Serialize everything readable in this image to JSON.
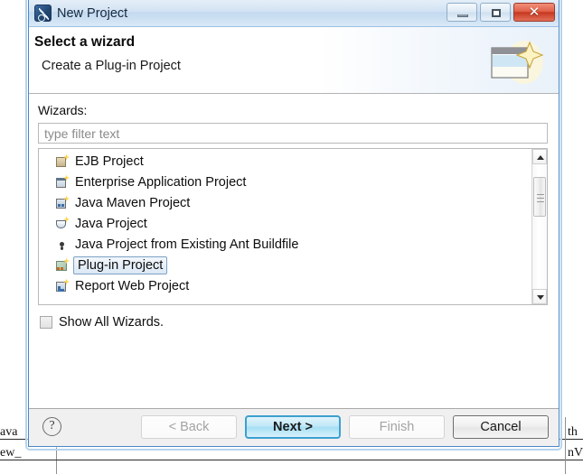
{
  "window": {
    "title": "New Project",
    "icon": "wizard-tool-icon",
    "controls": {
      "minimize": "minimize",
      "maximize": "maximize",
      "close": "✕"
    }
  },
  "header": {
    "title": "Select a wizard",
    "subtitle": "Create a Plug-in Project",
    "banner_icon": "wizard-banner-icon"
  },
  "form": {
    "wizards_label": "Wizards:",
    "filter_placeholder": "type filter text",
    "filter_value": ""
  },
  "tree": {
    "items": [
      {
        "label": "EJB Project",
        "icon": "ejb-project-icon",
        "selected": false
      },
      {
        "label": "Enterprise Application Project",
        "icon": "enterprise-application-project-icon",
        "selected": false
      },
      {
        "label": "Java Maven Project",
        "icon": "java-maven-project-icon",
        "selected": false
      },
      {
        "label": "Java Project",
        "icon": "java-project-icon",
        "selected": false
      },
      {
        "label": "Java Project from Existing Ant Buildfile",
        "icon": "ant-buildfile-icon",
        "selected": false
      },
      {
        "label": "Plug-in Project",
        "icon": "plugin-project-icon",
        "selected": true
      },
      {
        "label": "Report Web Project",
        "icon": "report-web-project-icon",
        "selected": false
      }
    ]
  },
  "options": {
    "show_all_wizards_label": "Show All Wizards.",
    "show_all_wizards_checked": false
  },
  "footer": {
    "help_label": "?",
    "back_label": "< Back",
    "next_label": "Next >",
    "finish_label": "Finish",
    "cancel_label": "Cancel"
  },
  "background": {
    "left_text_top": "ava",
    "left_text_bottom": "ew_",
    "right_text_top": "th",
    "right_text_bottom": "nV"
  },
  "colors": {
    "accent": "#3c9fd0",
    "title_bar": "#d3e3f3",
    "close_button": "#c8371f",
    "selection": "#dbe8f5",
    "dialog_border": "#4a87c4"
  }
}
